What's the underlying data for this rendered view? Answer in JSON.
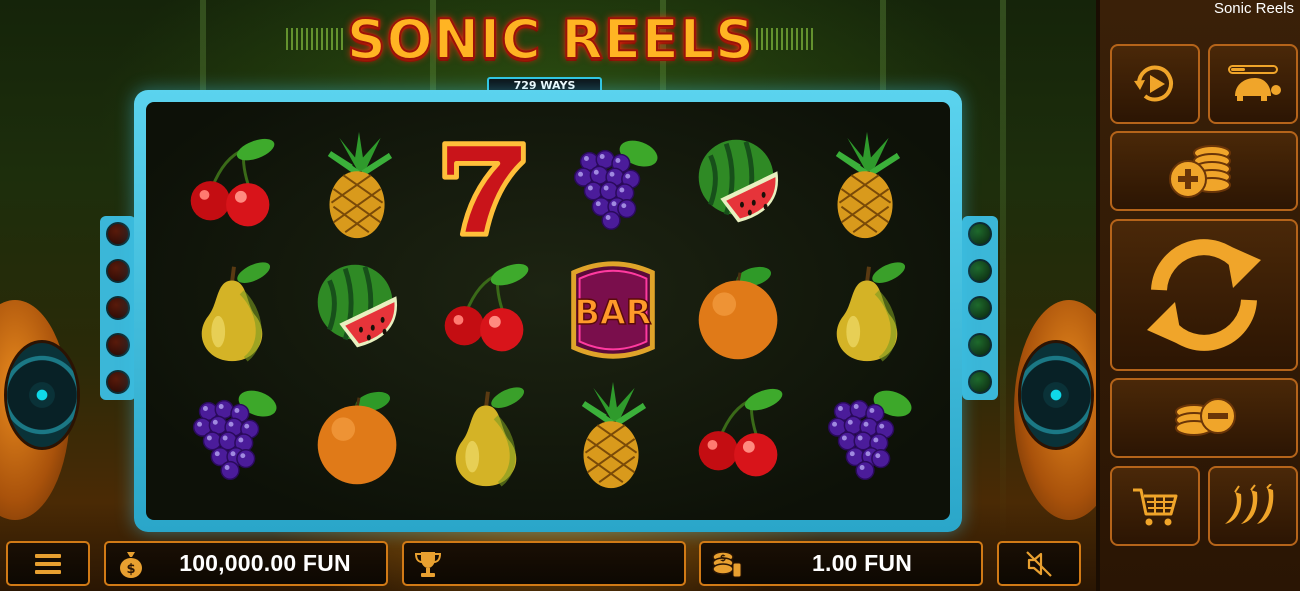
{
  "window": {
    "title": "Sonic Reels"
  },
  "logo": {
    "title": "SONIC REELS",
    "ways": "729 WAYS"
  },
  "reels": [
    [
      "cherry",
      "pineapple",
      "seven",
      "grapes",
      "watermelon",
      "pineapple"
    ],
    [
      "pear",
      "watermelon",
      "cherry",
      "bar",
      "orange",
      "pear"
    ],
    [
      "grapes",
      "orange",
      "pear",
      "pineapple",
      "cherry",
      "grapes"
    ]
  ],
  "symbols": {
    "bar_label": "BAR",
    "seven_label": "7"
  },
  "bottom_bar": {
    "balance": "100,000.00 FUN",
    "win": "",
    "bet": "1.00 FUN"
  },
  "icons": {
    "menu": "hamburger-icon",
    "balance": "money-bag-icon",
    "win": "trophy-icon",
    "bet": "coin-stack-icon",
    "sound": "speaker-muted-icon",
    "autoplay": "autoplay-icon",
    "turbo": "turtle-icon",
    "bet_up": "coins-plus-icon",
    "spin": "spin-arrows-icon",
    "bet_down": "coins-minus-icon",
    "buy": "cart-icon",
    "feature": "chili-icon"
  },
  "colors": {
    "accent": "#d17a16",
    "frame": "#3bb7d8",
    "logo": "#ffb423"
  }
}
